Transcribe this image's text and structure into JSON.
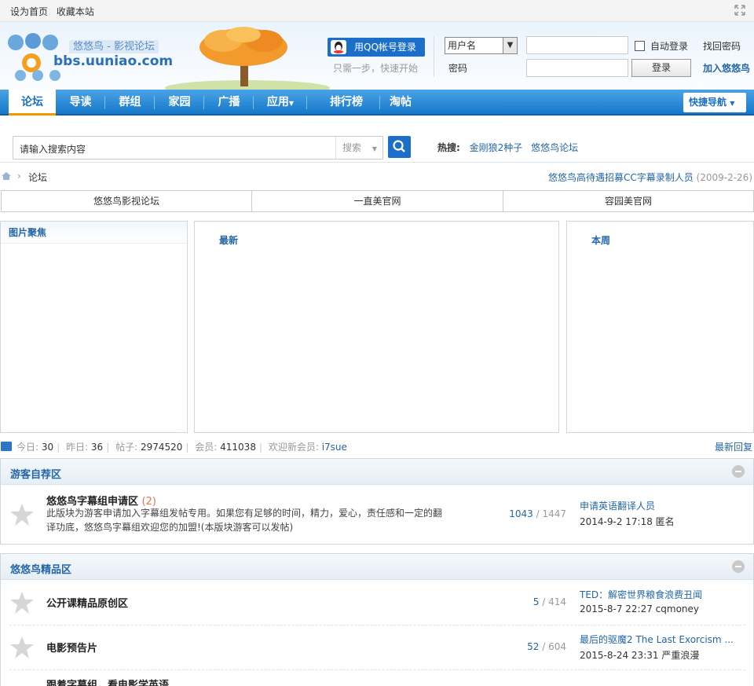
{
  "topbar": {
    "set_home": "设为首页",
    "bookmark": "收藏本站"
  },
  "header": {
    "site_tag": "悠悠鸟 - 影视论坛",
    "domain": "bbs.uuniao.com",
    "qq_login": "用QQ帐号登录",
    "qq_sub": "只需一步，快速开始",
    "username_select": "用户名",
    "password_label": "密码",
    "auto_login": "自动登录",
    "find_password": "找回密码",
    "login_button": "登录",
    "join": "加入悠悠鸟"
  },
  "nav": {
    "items": [
      "论坛",
      "导读",
      "群组",
      "家园",
      "广播",
      "应用",
      "排行榜",
      "淘帖"
    ],
    "quick_nav": "快捷导航"
  },
  "search": {
    "placeholder": "请输入搜索内容",
    "type": "搜索",
    "hot_label": "热搜:",
    "hot_items": [
      "金刚狼2种子",
      "悠悠鸟论坛"
    ]
  },
  "breadcrumb": {
    "current": "论坛",
    "announcement": "悠悠鸟高待遇招募CC字幕录制人员",
    "announcement_date": "(2009-2-26)"
  },
  "site_tabs": [
    "悠悠鸟影视论坛",
    "一直美官网",
    "容园美官网"
  ],
  "panels": {
    "pics": "图片聚焦",
    "latest": "最新",
    "week": "本周"
  },
  "stats": {
    "today_label": "今日:",
    "today": "30",
    "yesterday_label": "昨日:",
    "yesterday": "36",
    "posts_label": "帖子:",
    "posts": "2974520",
    "members_label": "会员:",
    "members": "411038",
    "welcome_label": "欢迎新会员:",
    "new_member": "i7sue",
    "latest_reply": "最新回复"
  },
  "sections": [
    {
      "title": "游客自荐区",
      "forums": [
        {
          "name": "悠悠鸟字幕组申请区",
          "count": "(2)",
          "desc": "此版块为游客申请加入字幕组发帖专用。如果您有足够的时间，精力，爱心，责任感和一定的翻译功底，悠悠鸟字幕组欢迎您的加盟!(本版块游客可以发帖)",
          "threads": "1043",
          "posts": "1447",
          "last_title": "申请英语翻译人员",
          "last_meta": "2014-9-2 17:18 匿名"
        }
      ]
    },
    {
      "title": "悠悠鸟精品区",
      "forums": [
        {
          "name": "公开课精品原创区",
          "threads": "5",
          "posts": "414",
          "last_title": "TED：解密世界粮食浪费丑闻",
          "last_meta": "2015-8-7 22:27 cqmoney"
        },
        {
          "name": "电影预告片",
          "threads": "52",
          "posts": "604",
          "last_title": "最后的驱魔2 The Last Exorcism ...",
          "last_meta": "2015-8-24 23:31 严重浪漫"
        },
        {
          "name": "跟着字幕组，看电影学英语"
        }
      ]
    }
  ]
}
